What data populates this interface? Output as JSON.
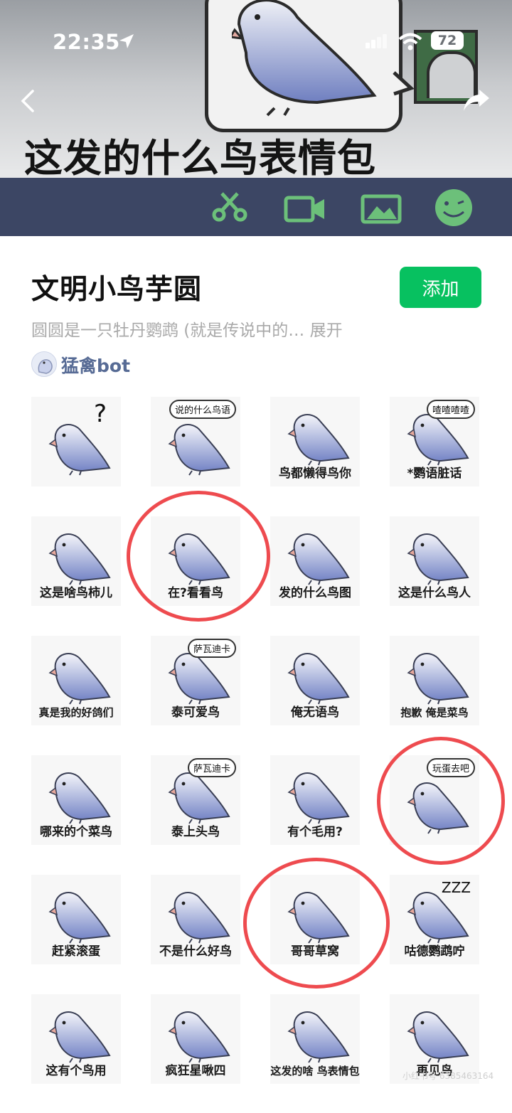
{
  "status_bar": {
    "time": "22:35",
    "battery": "72"
  },
  "banner": {
    "title": "这发的什么鸟表情包"
  },
  "pack": {
    "title": "文明小鸟芋圆",
    "add_label": "添加",
    "description": "圆圆是一只牡丹鹦鹉 (就是传说中的… 展开",
    "author": "猛禽bot"
  },
  "stickers": [
    {
      "caption": "",
      "bubble": "?"
    },
    {
      "caption": "",
      "bubble": "说的什么鸟语"
    },
    {
      "caption": "鸟都懒得鸟你",
      "bubble": ""
    },
    {
      "caption": "*鹦语脏话",
      "bubble": "喳喳喳喳"
    },
    {
      "caption": "这是啥鸟柿儿",
      "bubble": ""
    },
    {
      "caption": "在?看看鸟",
      "bubble": ""
    },
    {
      "caption": "发的什么鸟图",
      "bubble": ""
    },
    {
      "caption": "这是什么鸟人",
      "bubble": ""
    },
    {
      "caption": "真是我的好鸽们",
      "bubble": ""
    },
    {
      "caption": "泰可爱鸟",
      "bubble": "萨瓦迪卡"
    },
    {
      "caption": "俺无语鸟",
      "bubble": ""
    },
    {
      "caption": "抱歉 俺是菜鸟",
      "bubble": ""
    },
    {
      "caption": "哪来的个菜鸟",
      "bubble": ""
    },
    {
      "caption": "泰上头鸟",
      "bubble": "萨瓦迪卡"
    },
    {
      "caption": "有个毛用?",
      "bubble": ""
    },
    {
      "caption": "",
      "bubble": "玩蛋去吧"
    },
    {
      "caption": "赶紧滚蛋",
      "bubble": ""
    },
    {
      "caption": "不是什么好鸟",
      "bubble": ""
    },
    {
      "caption": "哥哥草窝",
      "bubble": ""
    },
    {
      "caption": "咕德鹦鹉咛",
      "bubble": "ZZZ"
    },
    {
      "caption": "这有个鸟用",
      "bubble": ""
    },
    {
      "caption": "疯狂星啾四",
      "bubble": ""
    },
    {
      "caption": "这发的啥 鸟表情包",
      "bubble": ""
    },
    {
      "caption": "再见鸟",
      "bubble": ""
    }
  ],
  "watermark": "小红书号 6385463164",
  "colors": {
    "add_button": "#07c160",
    "author_link": "#576b95",
    "highlight_circle": "#ee4b4f",
    "banner_strip": "#3c4664"
  }
}
